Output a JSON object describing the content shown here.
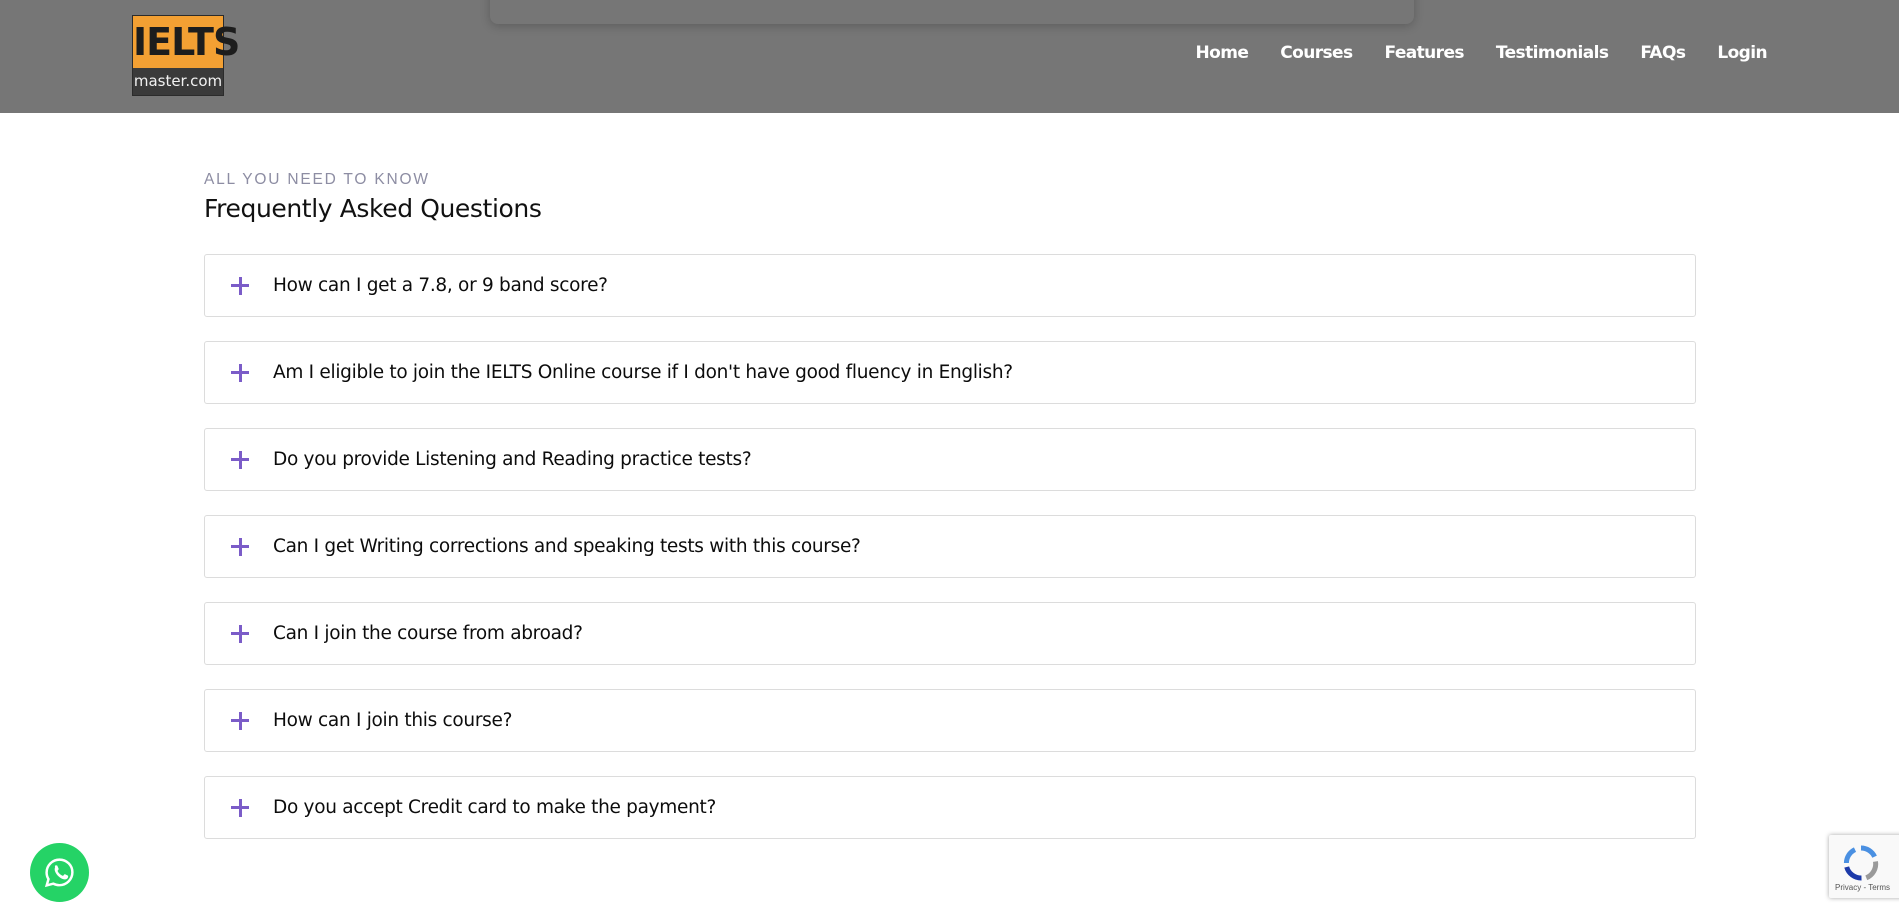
{
  "logo": {
    "line1": "IELTS",
    "line2": "master.com"
  },
  "nav": {
    "items": [
      "Home",
      "Courses",
      "Features",
      "Testimonials",
      "FAQs",
      "Login"
    ]
  },
  "faq": {
    "eyebrow": "ALL YOU NEED TO KNOW",
    "title": "Frequently Asked Questions",
    "questions": [
      "How can I get a 7.8, or 9 band score?",
      "Am I eligible to join the IELTS Online course if I don't have good fluency in English?",
      "Do you provide Listening and Reading practice tests?",
      "Can I get Writing corrections and speaking tests with this course?",
      "Can I join the course from abroad?",
      "How can I join this course?",
      "Do you accept Credit card to make the payment?"
    ]
  },
  "recaptcha": {
    "privacy": "Privacy",
    "separator": " - ",
    "terms": "Terms"
  },
  "colors": {
    "header_bg": "#767676",
    "accent_plus": "#7b5cc8",
    "logo_orange": "#f3a033",
    "whatsapp_green": "#25d366"
  },
  "icons": {
    "expand": "plus-icon",
    "chat": "whatsapp-icon",
    "captcha": "recaptcha-icon"
  }
}
